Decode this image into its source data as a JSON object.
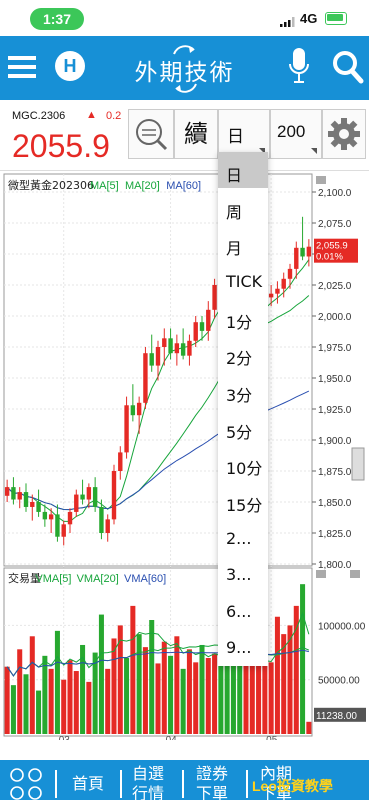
{
  "status": {
    "time": "1:37",
    "network": "4G"
  },
  "header": {
    "title": "外期技術"
  },
  "quote": {
    "symbol": "MGC.2306",
    "change_arrow": "▲",
    "change": "0.2",
    "price": "2055.9",
    "continuous_label": "續",
    "period_value": "日",
    "count_value": "200"
  },
  "dropdown": {
    "items": [
      "日",
      "周",
      "月",
      "TICK",
      "1分",
      "2分",
      "3分",
      "5分",
      "10分",
      "15分",
      "2...",
      "3...",
      "6...",
      "9..."
    ],
    "selected": "日"
  },
  "chart_data": [
    {
      "type": "candlestick",
      "title": "微型黃金202306",
      "legend": [
        {
          "name": "MA[5]",
          "color": "#17a53b"
        },
        {
          "name": "MA[20]",
          "color": "#17a53b"
        },
        {
          "name": "MA[60]",
          "color": "#2a4fb0"
        }
      ],
      "y_ticks": [
        "2,100.0",
        "2,075.0",
        "2,050.0",
        "2,025.0",
        "2,000.0",
        "1,975.0",
        "1,950.0",
        "1,925.0",
        "1,900.0",
        "1,875.0",
        "1,850.0",
        "1,825.0",
        "1,800.0"
      ],
      "ylim": [
        1800,
        2100
      ],
      "last_price_label": "2,055.9",
      "last_change_label": "0.01%",
      "candles": [
        [
          1855,
          1868,
          1850,
          1862
        ],
        [
          1862,
          1870,
          1848,
          1852
        ],
        [
          1852,
          1862,
          1845,
          1858
        ],
        [
          1858,
          1865,
          1842,
          1846
        ],
        [
          1846,
          1856,
          1835,
          1850
        ],
        [
          1850,
          1860,
          1838,
          1842
        ],
        [
          1842,
          1848,
          1830,
          1836
        ],
        [
          1836,
          1845,
          1825,
          1840
        ],
        [
          1840,
          1848,
          1818,
          1822
        ],
        [
          1822,
          1835,
          1815,
          1832
        ],
        [
          1832,
          1845,
          1825,
          1842
        ],
        [
          1842,
          1860,
          1838,
          1856
        ],
        [
          1856,
          1868,
          1848,
          1852
        ],
        [
          1852,
          1865,
          1845,
          1862
        ],
        [
          1862,
          1870,
          1842,
          1846
        ],
        [
          1846,
          1852,
          1820,
          1825
        ],
        [
          1825,
          1840,
          1818,
          1836
        ],
        [
          1836,
          1880,
          1832,
          1875
        ],
        [
          1875,
          1895,
          1868,
          1890
        ],
        [
          1890,
          1935,
          1885,
          1928
        ],
        [
          1928,
          1945,
          1915,
          1920
        ],
        [
          1920,
          1935,
          1905,
          1930
        ],
        [
          1930,
          1975,
          1925,
          1970
        ],
        [
          1970,
          1985,
          1955,
          1960
        ],
        [
          1960,
          1980,
          1948,
          1975
        ],
        [
          1975,
          1990,
          1960,
          1982
        ],
        [
          1982,
          1990,
          1965,
          1970
        ],
        [
          1970,
          1985,
          1960,
          1978
        ],
        [
          1978,
          1990,
          1965,
          1968
        ],
        [
          1968,
          1985,
          1960,
          1980
        ],
        [
          1980,
          2000,
          1975,
          1995
        ],
        [
          1995,
          2000,
          1980,
          1988
        ],
        [
          1988,
          2012,
          1980,
          2005
        ],
        [
          2005,
          2030,
          1998,
          2025
        ],
        [
          2025,
          2040,
          2010,
          2020
        ],
        [
          2020,
          2030,
          2008,
          2015
        ],
        [
          2015,
          2025,
          2000,
          2005
        ],
        [
          2005,
          2015,
          1990,
          1995
        ],
        [
          1995,
          2010,
          1985,
          2002
        ],
        [
          2002,
          2012,
          1995,
          2008
        ],
        [
          2008,
          2018,
          2000,
          2010
        ],
        [
          2010,
          2020,
          2002,
          2015
        ],
        [
          2015,
          2025,
          2008,
          2018
        ],
        [
          2018,
          2028,
          2010,
          2022
        ],
        [
          2022,
          2035,
          2015,
          2030
        ],
        [
          2030,
          2042,
          2022,
          2038
        ],
        [
          2038,
          2060,
          2030,
          2055
        ],
        [
          2055,
          2080,
          2045,
          2048
        ],
        [
          2048,
          2062,
          2040,
          2055.9
        ]
      ]
    },
    {
      "type": "bar",
      "title": "交易量",
      "legend": [
        {
          "name": "VMA[5]",
          "color": "#17a53b"
        },
        {
          "name": "VMA[20]",
          "color": "#17a53b"
        },
        {
          "name": "VMA[60]",
          "color": "#2a4fb0"
        }
      ],
      "y_ticks": [
        "100000.00",
        "50000.00"
      ],
      "ylim": [
        0,
        140000
      ],
      "last_volume_label": "11238.00",
      "x_ticks": [
        "03",
        "04",
        "05"
      ],
      "values": [
        62000,
        45000,
        78000,
        55000,
        90000,
        40000,
        72000,
        60000,
        95000,
        50000,
        68000,
        58000,
        82000,
        48000,
        75000,
        110000,
        60000,
        88000,
        100000,
        70000,
        118000,
        92000,
        80000,
        105000,
        65000,
        85000,
        72000,
        90000,
        60000,
        78000,
        66000,
        82000,
        70000,
        74000,
        68000,
        72000,
        64000,
        70000,
        66000,
        70000,
        64000,
        68000,
        66000,
        108000,
        92000,
        100000,
        118000,
        138000,
        11238
      ],
      "up": [
        1,
        0,
        1,
        0,
        1,
        0,
        0,
        1,
        0,
        1,
        1,
        1,
        0,
        1,
        0,
        0,
        1,
        1,
        1,
        0,
        1,
        0,
        1,
        0,
        1,
        1,
        0,
        1,
        0,
        1,
        1,
        0,
        1,
        1,
        0,
        0,
        0,
        0,
        1,
        1,
        1,
        1,
        1,
        1,
        1,
        1,
        1,
        0,
        1
      ]
    }
  ],
  "bottom_nav": {
    "items": [
      "首頁",
      "自選行情",
      "證券下單",
      "內期下單"
    ],
    "watermark": "Leo投資教學"
  },
  "colors": {
    "brand_blue": "#1790d6",
    "up_red": "#e52a25",
    "down_green": "#27a82f"
  }
}
